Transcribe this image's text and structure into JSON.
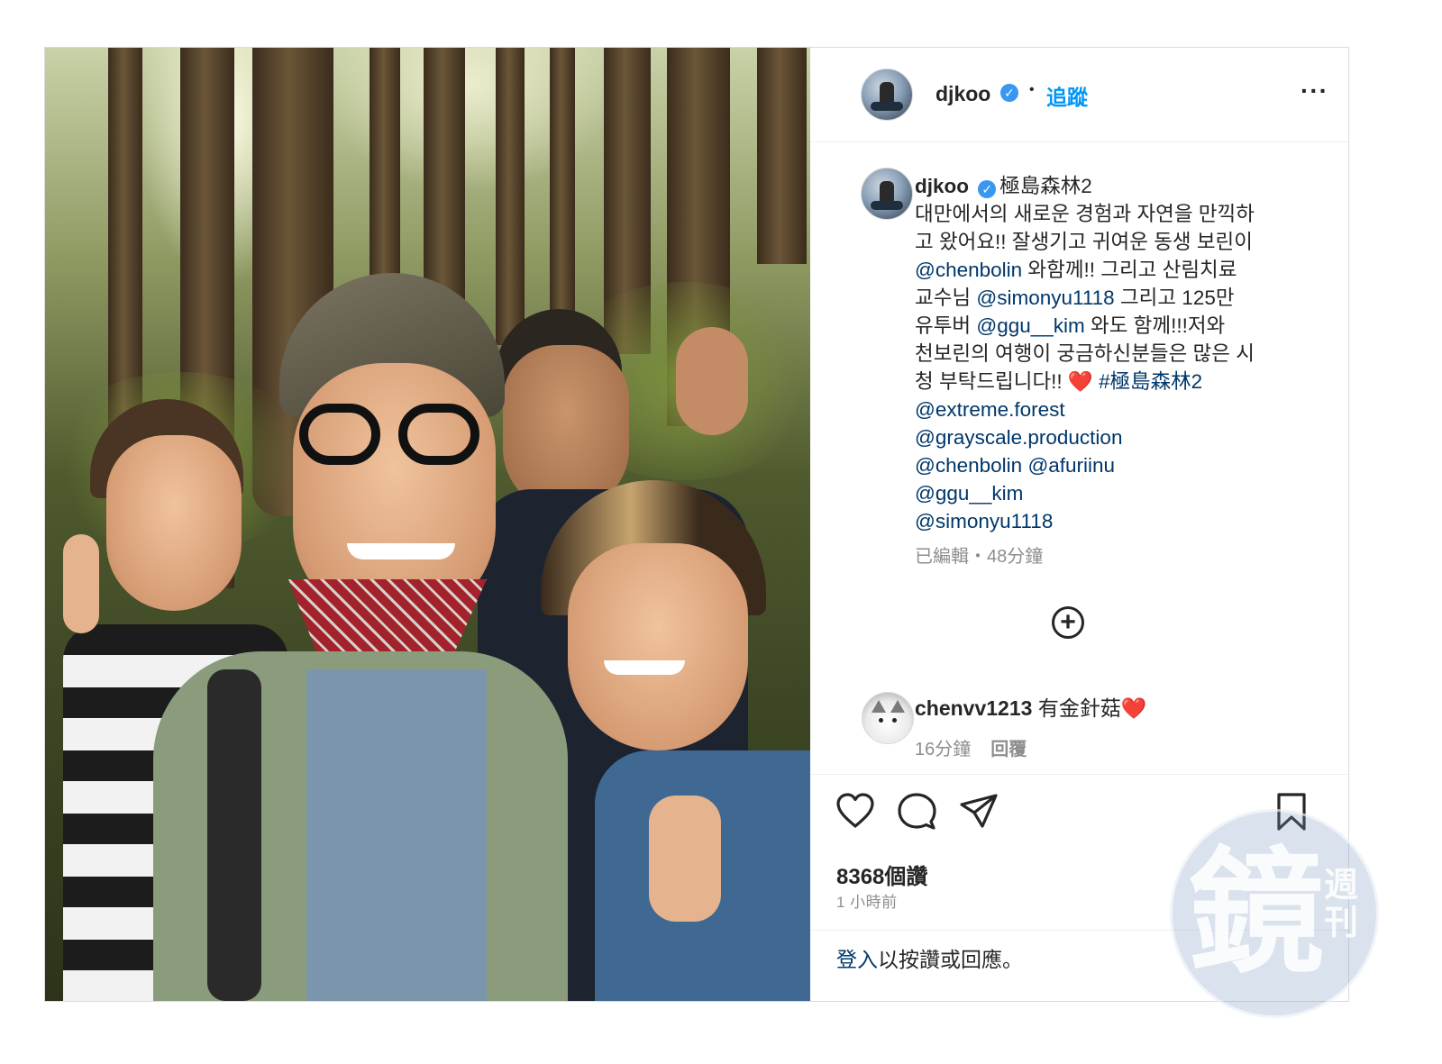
{
  "header": {
    "username": "djkoo",
    "verified_badge": "✓",
    "separator": "•",
    "follow_label": "追蹤",
    "more_label": "···"
  },
  "caption": {
    "username": "djkoo",
    "verified_badge": "✓",
    "lines": [
      [
        {
          "t": "極島森林2",
          "c": "text"
        }
      ],
      [
        {
          "t": "대만에서의 새로운 경험과 자연을 만끽하",
          "c": "text"
        }
      ],
      [
        {
          "t": "고 왔어요!! 잘생기고 귀여운 동생 보린이",
          "c": "text"
        }
      ],
      [
        {
          "t": "@chenbolin",
          "c": "link"
        },
        {
          "t": " 와함께!! 그리고 산림치료",
          "c": "text"
        }
      ],
      [
        {
          "t": "교수님 ",
          "c": "text"
        },
        {
          "t": "@simonyu1118",
          "c": "link"
        },
        {
          "t": " 그리고 125만",
          "c": "text"
        }
      ],
      [
        {
          "t": "유투버 ",
          "c": "text"
        },
        {
          "t": "@ggu__kim",
          "c": "link"
        },
        {
          "t": " 와도 함께!!!저와",
          "c": "text"
        }
      ],
      [
        {
          "t": "천보린의 여행이 궁금하신분들은 많은 시",
          "c": "text"
        }
      ],
      [
        {
          "t": "청 부탁드립니다!! ",
          "c": "text"
        },
        {
          "t": "❤️",
          "c": "heart"
        },
        {
          "t": " #極島森林2",
          "c": "link"
        }
      ],
      [
        {
          "t": "@extreme.forest",
          "c": "link"
        }
      ],
      [
        {
          "t": "@grayscale.production",
          "c": "link"
        }
      ],
      [
        {
          "t": "@chenbolin",
          "c": "link"
        },
        {
          "t": " ",
          "c": "text"
        },
        {
          "t": "@afuriinu",
          "c": "link"
        }
      ],
      [
        {
          "t": "@ggu__kim",
          "c": "link"
        }
      ],
      [
        {
          "t": "@simonyu1118",
          "c": "link"
        }
      ]
    ],
    "meta": "已編輯・48分鐘"
  },
  "load_more_label": "+",
  "comment": {
    "username": "chenvv1213",
    "text": "有金針菇",
    "heart": "❤️",
    "time": "16分鐘",
    "reply_label": "回覆"
  },
  "stats": {
    "likes": "8368個讚",
    "time": "1 小時前"
  },
  "login_prompt": {
    "link": "登入",
    "rest": "以按讚或回應。"
  },
  "watermark": {
    "big": "鏡",
    "small": "週刊"
  },
  "colors": {
    "link": "#00376b",
    "follow": "#0095f6",
    "verified": "#3897f0",
    "heart": "#e0202c",
    "muted": "#8e8e8e"
  }
}
